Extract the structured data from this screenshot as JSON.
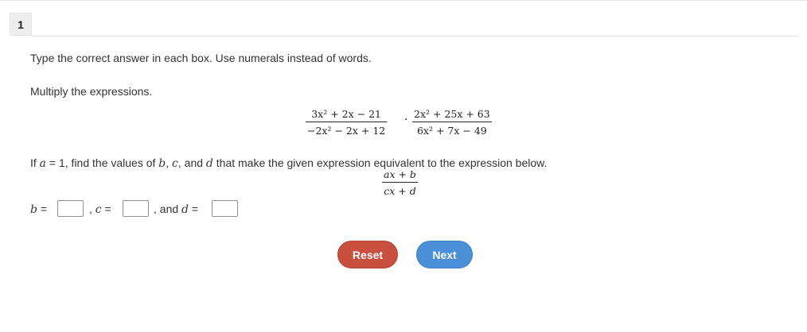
{
  "question": {
    "number": "1",
    "instruction": "Type the correct answer in each box. Use numerals instead of words.",
    "prompt": "Multiply the expressions.",
    "expression": {
      "frac1_num": "3x² + 2x − 21",
      "frac1_den": "−2x² − 2x + 12",
      "operator": "·",
      "frac2_num": "2x² + 25x + 63",
      "frac2_den": "6x² + 7x − 49"
    },
    "condition": {
      "part1": "If ",
      "var_a": "a",
      "part2": " = 1, find the values of ",
      "var_b": "b",
      "comma1": ", ",
      "var_c": "c",
      "part3": ", and ",
      "var_d": "d",
      "part4": " that make the given expression equivalent to the expression below."
    },
    "target": {
      "num": "ax + b",
      "den": "cx + d"
    },
    "answers": {
      "b_label": "b",
      "b_eq": " =",
      "c_sep": ", ",
      "c_label": "c",
      "c_eq": " =",
      "d_sep": ", and ",
      "d_label": "d",
      "d_eq": " =",
      "b_value": "",
      "c_value": "",
      "d_value": ""
    }
  },
  "buttons": {
    "reset_label": "Reset",
    "next_label": "Next"
  },
  "colors": {
    "reset": "#c9503e",
    "next": "#4a90d9"
  }
}
